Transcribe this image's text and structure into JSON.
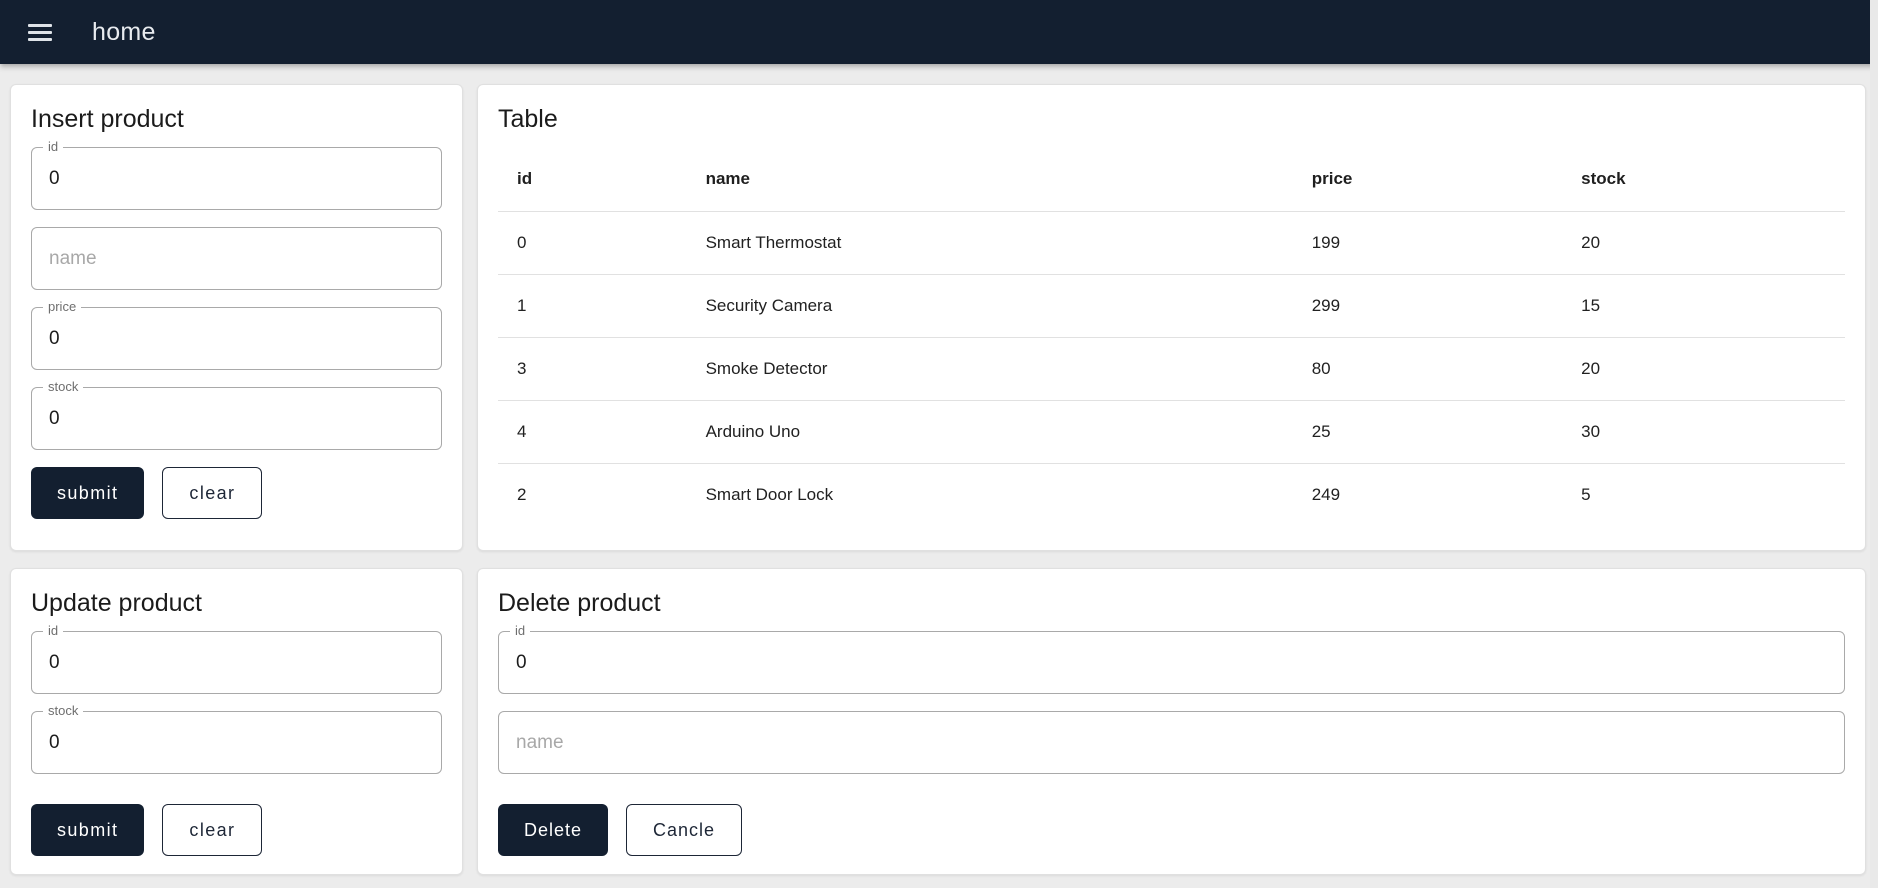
{
  "colors": {
    "primary": "#131f30",
    "page_background": "#ececec"
  },
  "app_bar": {
    "title": "home"
  },
  "insert_card": {
    "title": "Insert product",
    "id_field": {
      "label": "id",
      "value": "0"
    },
    "name_field": {
      "placeholder": "name"
    },
    "price_field": {
      "label": "price",
      "value": "0"
    },
    "stock_field": {
      "label": "stock",
      "value": "0"
    },
    "buttons": {
      "submit": "submit",
      "clear": "clear"
    }
  },
  "table_card": {
    "title": "Table",
    "columns": {
      "id": "id",
      "name": "name",
      "price": "price",
      "stock": "stock"
    },
    "rows": [
      {
        "id": "0",
        "name": "Smart Thermostat",
        "price": "199",
        "stock": "20"
      },
      {
        "id": "1",
        "name": "Security Camera",
        "price": "299",
        "stock": "15"
      },
      {
        "id": "3",
        "name": "Smoke Detector",
        "price": "80",
        "stock": "20"
      },
      {
        "id": "4",
        "name": "Arduino Uno",
        "price": "25",
        "stock": "30"
      },
      {
        "id": "2",
        "name": "Smart Door Lock",
        "price": "249",
        "stock": "5"
      }
    ]
  },
  "update_card": {
    "title": "Update product",
    "id_field": {
      "label": "id",
      "value": "0"
    },
    "stock_field": {
      "label": "stock",
      "value": "0"
    },
    "buttons": {
      "submit": "submit",
      "clear": "clear"
    }
  },
  "delete_card": {
    "title": "Delete product",
    "id_field": {
      "label": "id",
      "value": "0"
    },
    "name_field": {
      "placeholder": "name"
    },
    "buttons": {
      "delete": "Delete",
      "cancel": "Cancle"
    }
  }
}
